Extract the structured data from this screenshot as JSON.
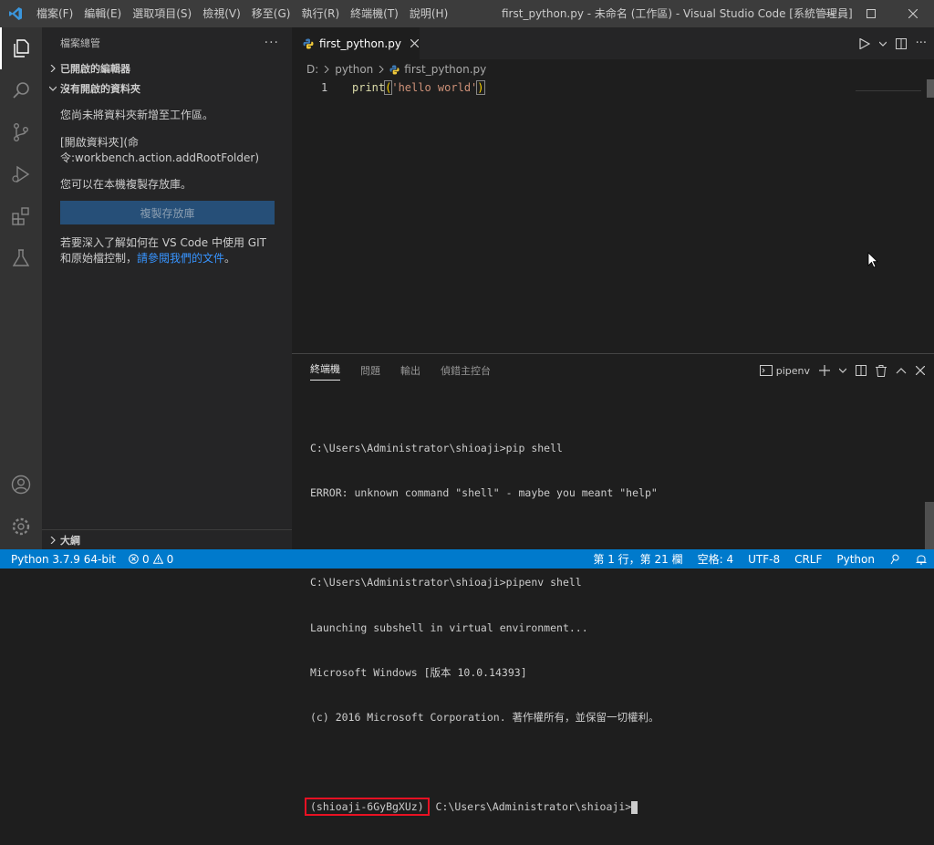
{
  "titlebar": {
    "menu": [
      "檔案(F)",
      "編輯(E)",
      "選取項目(S)",
      "檢視(V)",
      "移至(G)",
      "執行(R)",
      "終端機(T)",
      "說明(H)"
    ],
    "window_title": "first_python.py - 未命名 (工作區) - Visual Studio Code [系統管理員]"
  },
  "sidebar": {
    "header": "檔案總管",
    "open_editors": "已開啟的編輯器",
    "no_folder": "沒有開啟的資料夾",
    "msg1": "您尚未將資料夾新增至工作區。",
    "msg2a": "[開啟資料夾](命",
    "msg2b": "令:workbench.action.addRootFolder)",
    "msg3": "您可以在本機複製存放庫。",
    "clone_button": "複製存放庫",
    "msg4a": "若要深入了解如何在 VS Code 中使用 GIT",
    "msg4b": "和原始檔控制，",
    "msg4_link": "請參閱我們的文件",
    "msg4_end": "。",
    "outline": "大綱"
  },
  "editor": {
    "tab_label": "first_python.py",
    "breadcrumb": [
      "D:",
      "python",
      "first_python.py"
    ],
    "line_number": "1",
    "code_fn": "print",
    "code_open": "(",
    "code_str": "'hello world'",
    "code_close": ")"
  },
  "panel": {
    "tabs": [
      "終端機",
      "問題",
      "輸出",
      "偵錯主控台"
    ],
    "terminal_select": "pipenv",
    "lines": [
      "C:\\Users\\Administrator\\shioaji>pip shell",
      "ERROR: unknown command \"shell\" - maybe you meant \"help\"",
      "",
      "C:\\Users\\Administrator\\shioaji>pipenv shell",
      "Launching subshell in virtual environment...",
      "Microsoft Windows [版本 10.0.14393]",
      "(c) 2016 Microsoft Corporation. 著作權所有，並保留一切權利。",
      ""
    ],
    "env_prefix": "(shioaji-6GyBgXUz)",
    "prompt": " C:\\Users\\Administrator\\shioaji>"
  },
  "statusbar": {
    "python": "Python 3.7.9 64-bit",
    "errors": "0",
    "warnings": "0",
    "position": "第 1 行，第 21 欄",
    "spaces": "空格: 4",
    "encoding": "UTF-8",
    "eol": "CRLF",
    "language": "Python"
  },
  "colors": {
    "accent": "#007acc",
    "highlight_box": "#e81123"
  }
}
